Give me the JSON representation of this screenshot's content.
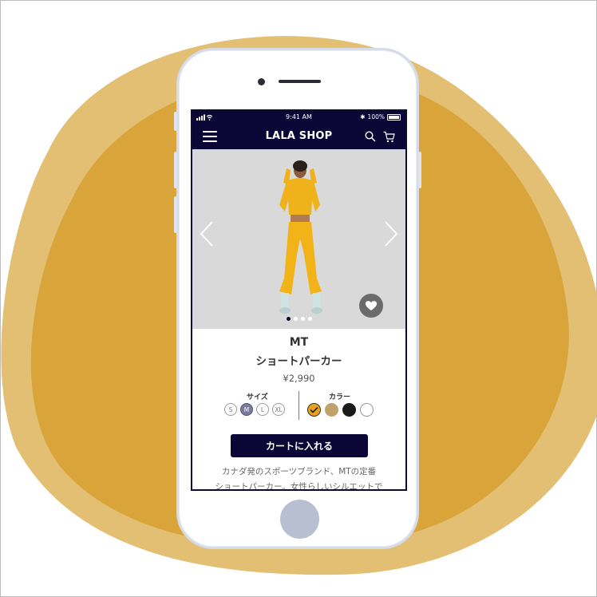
{
  "status_bar": {
    "time": "9:41 AM",
    "battery": "100%"
  },
  "header": {
    "title": "LALA SHOP"
  },
  "product": {
    "brand": "MT",
    "name": "ショートパーカー",
    "price": "¥2,990",
    "carousel": {
      "total": 4,
      "active": 1
    }
  },
  "options": {
    "size_label": "サイズ",
    "sizes": [
      "S",
      "M",
      "L",
      "XL"
    ],
    "selected_size": "M",
    "color_label": "カラー",
    "colors": [
      "#e8a21c",
      "#c2a06b",
      "#1a1a1a",
      "#ffffff"
    ],
    "selected_color": "#e8a21c"
  },
  "actions": {
    "add_to_cart": "カートに入れる"
  },
  "description": {
    "line1": "カナダ発のスポーツブランド、MTの定番",
    "line2": "ショートパーカー。女性らしいシルエットで"
  },
  "colors": {
    "brand_navy": "#0b0636",
    "background_blob": "#d9a43a"
  }
}
